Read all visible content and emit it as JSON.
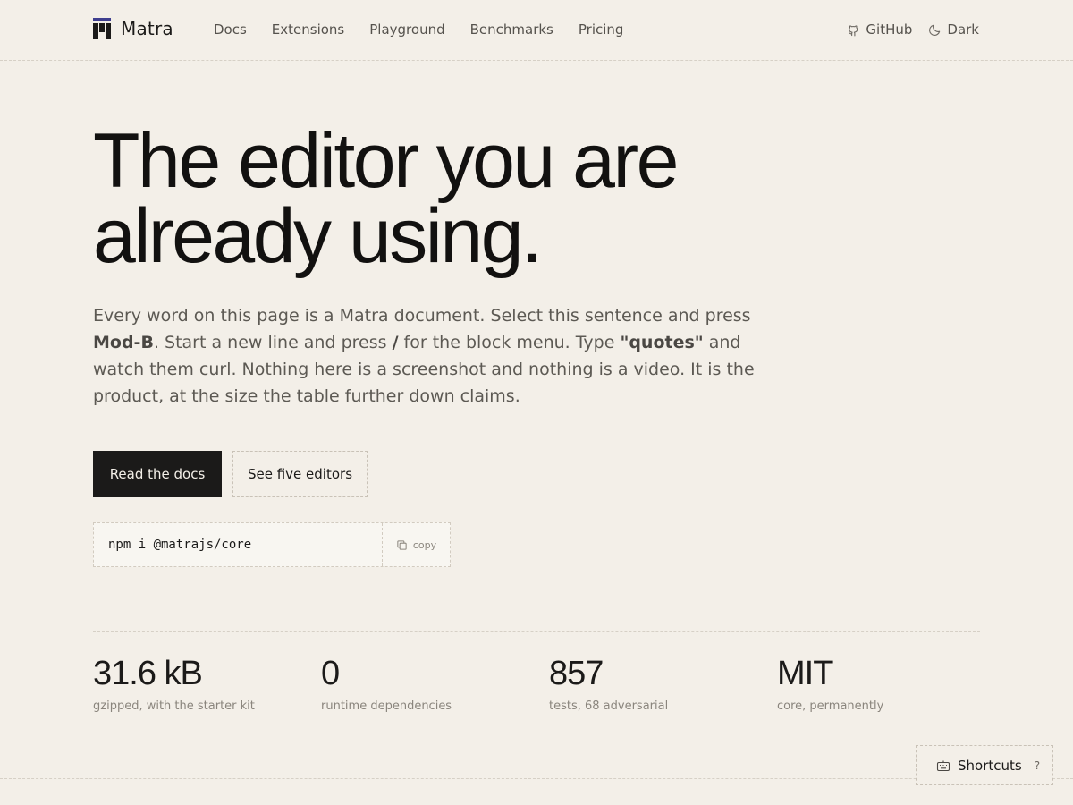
{
  "brand": {
    "name": "Matra"
  },
  "nav": {
    "items": [
      {
        "label": "Docs"
      },
      {
        "label": "Extensions"
      },
      {
        "label": "Playground"
      },
      {
        "label": "Benchmarks"
      },
      {
        "label": "Pricing"
      }
    ],
    "github_label": "GitHub",
    "theme_label": "Dark"
  },
  "hero": {
    "title_line1": "The editor you are",
    "title_line2": "already using.",
    "copy": {
      "p1": "Every word on this page is a Matra document. Select this sentence and press ",
      "kbd1": "Mod-B",
      "p2": ". Start a new line and press ",
      "kbd2": "/",
      "p3": " for the block menu. Type ",
      "kbd3": "\"quotes\"",
      "p4": " and watch them curl. Nothing here is a screenshot and nothing is a video. It is the product, at the size the table further down claims."
    },
    "primary_button": "Read the docs",
    "secondary_button": "See five editors",
    "install_command": "npm i @matrajs/core",
    "copy_label": "copy"
  },
  "stats": [
    {
      "value": "31.6 kB",
      "label": "gzipped, with the starter kit"
    },
    {
      "value": "0",
      "label": "runtime dependencies"
    },
    {
      "value": "857",
      "label": "tests, 68 adversarial"
    },
    {
      "value": "MIT",
      "label": "core, permanently"
    }
  ],
  "shortcuts": {
    "label": "Shortcuts",
    "key": "?"
  },
  "colors": {
    "background": "#f3efe8",
    "accent": "#3f3f8f",
    "ink": "#1b1a19"
  }
}
